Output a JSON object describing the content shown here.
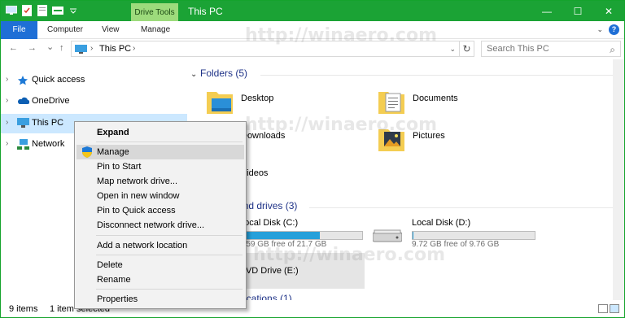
{
  "window": {
    "title": "This PC",
    "context_tab": "Drive Tools",
    "controls": {
      "minimize": "—",
      "maximize": "☐",
      "close": "✕"
    }
  },
  "ribbon": {
    "tabs": [
      "File",
      "Computer",
      "View",
      "Manage"
    ],
    "collapse_icon": "chevron-down-icon",
    "help": "?"
  },
  "nav": {
    "back": "←",
    "forward": "→",
    "recent": "⌄",
    "up": "↑",
    "address": "This PC",
    "separator": "›",
    "refresh": "↻",
    "search_placeholder": "Search This PC"
  },
  "navpane": {
    "items": [
      {
        "label": "Quick access",
        "icon": "star-icon",
        "expander": "›"
      },
      {
        "label": "OneDrive",
        "icon": "cloud-icon",
        "expander": "›"
      },
      {
        "label": "This PC",
        "icon": "computer-icon",
        "expander": "›",
        "selected": true
      },
      {
        "label": "Network",
        "icon": "network-icon",
        "expander": "›"
      }
    ]
  },
  "content": {
    "folders_header": "Folders (5)",
    "folders": [
      {
        "label": "Desktop",
        "icon": "desktop-folder-icon"
      },
      {
        "label": "Documents",
        "icon": "documents-folder-icon"
      },
      {
        "label": "Downloads",
        "icon": "downloads-folder-icon"
      },
      {
        "label": "Pictures",
        "icon": "pictures-folder-icon"
      },
      {
        "label": "Videos",
        "icon": "videos-folder-icon"
      }
    ],
    "drives_header": "Devices and drives (3)",
    "drives": [
      {
        "label": "Local Disk (C:)",
        "free": "7.59 GB free of 21.7 GB",
        "used_fraction": 0.65
      },
      {
        "label": "Local Disk (D:)",
        "free": "9.72 GB free of 9.76 GB",
        "used_fraction": 0.004
      },
      {
        "label": "DVD Drive (E:)",
        "free": ""
      }
    ],
    "locations_header": "Network locations (1)"
  },
  "status": {
    "count": "9 items",
    "selected": "1 item selected"
  },
  "context_menu": {
    "items": [
      "Expand",
      "Manage",
      "Pin to Start",
      "Map network drive...",
      "Open in new window",
      "Pin to Quick access",
      "Disconnect network drive...",
      "Add a network location",
      "Delete",
      "Rename",
      "Properties"
    ]
  },
  "watermark": "http://winaero.com",
  "colors": {
    "titlebar": "#1ba335",
    "file_tab": "#1f6fd6",
    "selection": "#cce8ff",
    "drive_fill": "#26a0da",
    "context_tab": "#9ddb7c"
  }
}
